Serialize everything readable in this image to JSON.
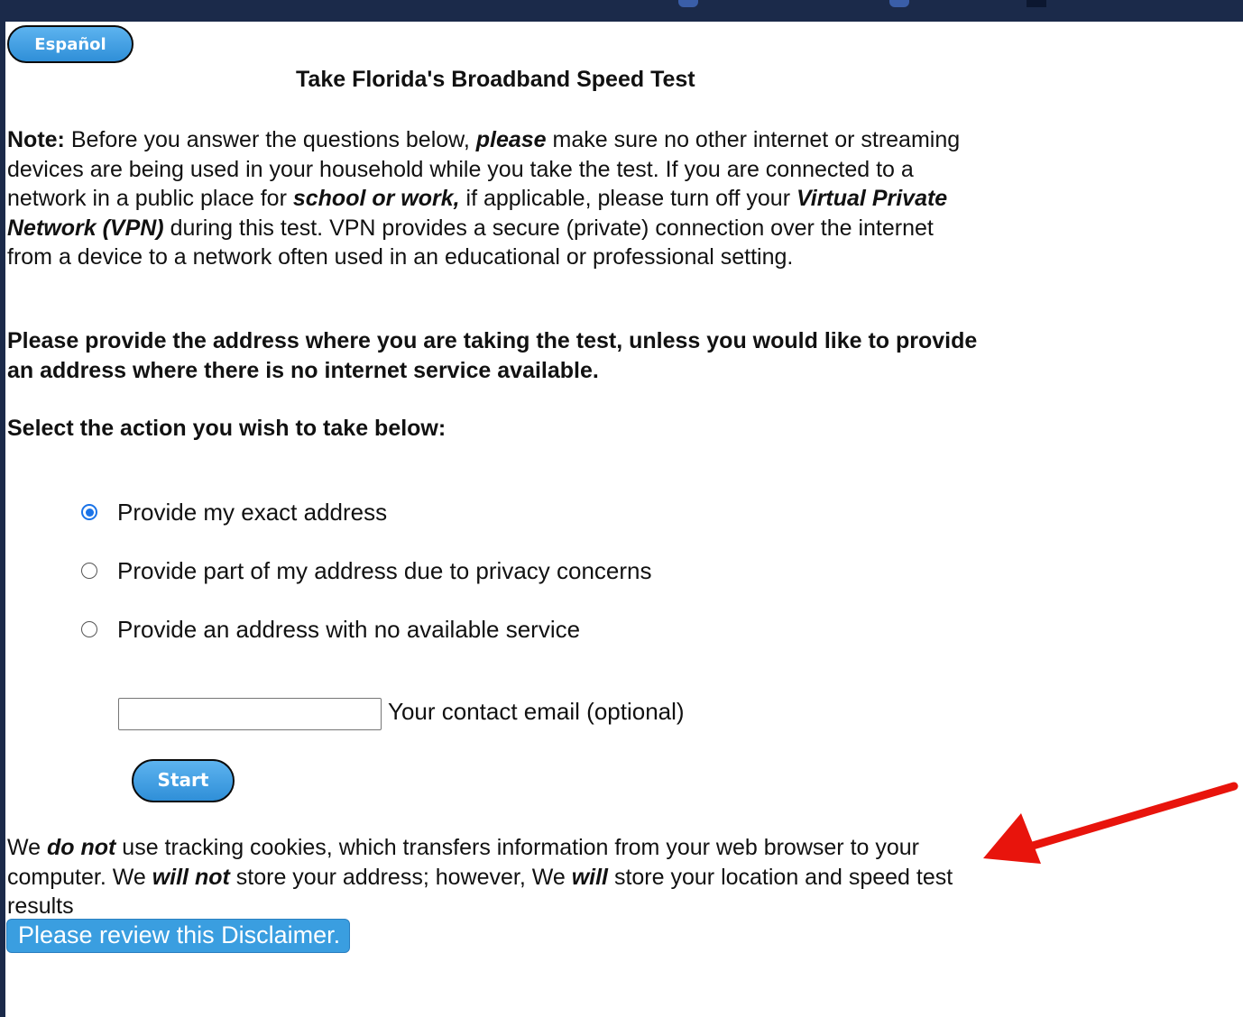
{
  "language_button": "Español",
  "title": "Take Florida's Broadband Speed Test",
  "note": {
    "label": "Note:",
    "t1": " Before you answer the questions below, ",
    "please": "please",
    "t2": " make sure no other internet or streaming devices are being used in your household while you take the test. If you are connected to a network in a public place for ",
    "school_work": "school or work,",
    "t3": " if applicable, please turn off your ",
    "vpn": "Virtual Private Network (VPN)",
    "t4": " during this test. VPN provides a secure (private) connection over the internet from a device to a network often used in an educational or professional setting."
  },
  "address_instruction": "Please provide the address where you are taking the test, unless you would like to provide an address where there is no internet service available.",
  "select_prompt": "Select the action you wish to take below:",
  "options": [
    {
      "label": "Provide my exact address",
      "checked": true
    },
    {
      "label": "Provide part of my address due to privacy concerns",
      "checked": false
    },
    {
      "label": "Provide an address with no available service",
      "checked": false
    }
  ],
  "email": {
    "value": "",
    "label": "Your contact email (optional)"
  },
  "start_button": "Start",
  "cookies": {
    "t1": "We ",
    "do_not": "do not",
    "t2": " use tracking cookies, which transfers information from your web browser to your computer. We ",
    "will_not": "will not",
    "t3": " store your address; however, We ",
    "will": "will",
    "t4": " store your location and speed test results"
  },
  "disclaimer_button": "Please review this Disclaimer.",
  "colors": {
    "frame": "#1b2a4a",
    "button_blue": "#3a9ee0",
    "radio_checked": "#1a73e8",
    "annotation_arrow": "#e8140c"
  }
}
